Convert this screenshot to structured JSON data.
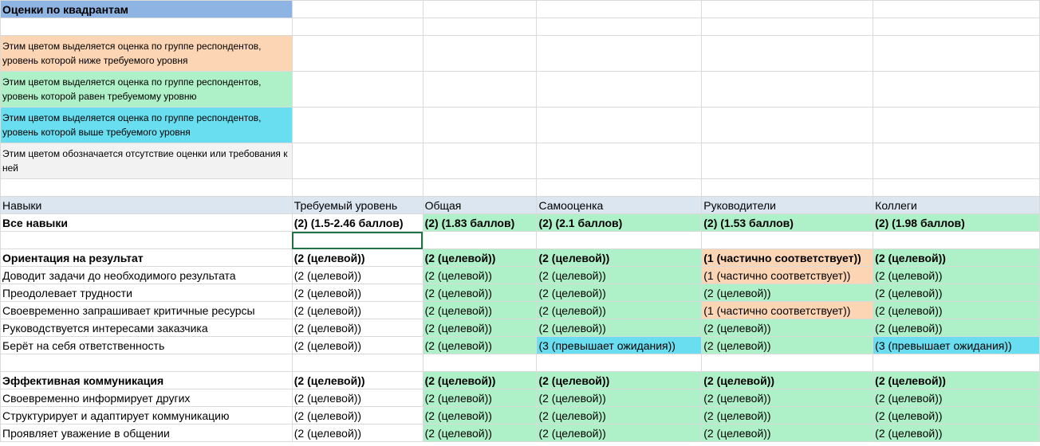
{
  "title": "Оценки по квадрантам",
  "legend": [
    {
      "text": "Этим цветом выделяется оценка по группе респондентов, уровень которой ниже требуемого уровня",
      "color": "#fcd5b4"
    },
    {
      "text": "Этим цветом выделяется оценка по группе респондентов, уровень которой равен требуемому уровню",
      "color": "#aef0c7"
    },
    {
      "text": "Этим цветом выделяется оценка по группе респондентов, уровень которой выше требуемого уровня",
      "color": "#69def0"
    },
    {
      "text": "Этим цветом обозначается отсутствие оценки или требования к ней",
      "color": "#f2f2f2"
    }
  ],
  "headers": [
    "Навыки",
    "Требуемый уровень",
    "Общая",
    "Самооценка",
    "Руководители",
    "Коллеги"
  ],
  "overall": [
    "Все навыки",
    "(2) (1.5-2.46 баллов)",
    "(2) (1.83 баллов)",
    "(2) (2.1 баллов)",
    "(2) (1.53 баллов)",
    "(2) (1.98 баллов)"
  ],
  "groups": [
    {
      "title": [
        "Ориентация на результат",
        "(2 (целевой))",
        "(2 (целевой))",
        "(2 (целевой))",
        "(1 (частично соответствует))",
        "(2 (целевой))"
      ],
      "rows": [
        [
          "Доводит задачи до необходимого результата",
          "(2 (целевой))",
          "(2 (целевой))",
          "(2 (целевой))",
          "(1 (частично соответствует))",
          "(2 (целевой))"
        ],
        [
          "Преодолевает трудности",
          "(2 (целевой))",
          "(2 (целевой))",
          "(2 (целевой))",
          "(2 (целевой))",
          "(2 (целевой))"
        ],
        [
          "Своевременно запрашивает критичные ресурсы",
          "(2 (целевой))",
          "(2 (целевой))",
          "(2 (целевой))",
          "(1 (частично соответствует))",
          "(2 (целевой))"
        ],
        [
          "Руководствуется интересами заказчика",
          "(2 (целевой))",
          "(2 (целевой))",
          "(2 (целевой))",
          "(2 (целевой))",
          "(2 (целевой))"
        ],
        [
          "Берёт на себя ответственность",
          "(2 (целевой))",
          "(2 (целевой))",
          "(3 (превышает ожидания))",
          "(2 (целевой))",
          "(3 (превышает ожидания))"
        ]
      ]
    },
    {
      "title": [
        "Эффективная коммуникация",
        "(2 (целевой))",
        "(2 (целевой))",
        "(2 (целевой))",
        "(2 (целевой))",
        "(2 (целевой))"
      ],
      "rows": [
        [
          "Своевременно информирует других",
          "(2 (целевой))",
          "(2 (целевой))",
          "(2 (целевой))",
          "(2 (целевой))",
          "(2 (целевой))"
        ],
        [
          "Структурирует и адаптирует коммуникацию",
          "(2 (целевой))",
          "(2 (целевой))",
          "(2 (целевой))",
          "(2 (целевой))",
          "(2 (целевой))"
        ],
        [
          "Проявляет уважение в общении",
          "(2 (целевой))",
          "(2 (целевой))",
          "(2 (целевой))",
          "(2 (целевой))",
          "(2 (целевой))"
        ]
      ]
    }
  ]
}
